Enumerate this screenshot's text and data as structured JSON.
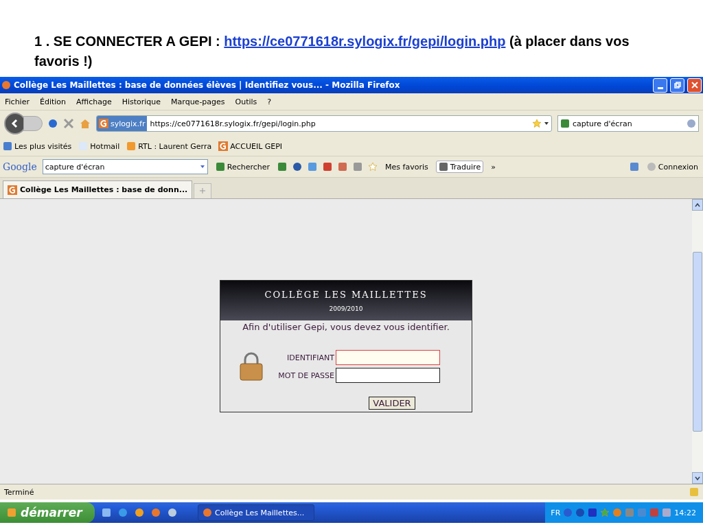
{
  "slide_heading": {
    "prefix": "1 . SE CONNECTER A GEPI : ",
    "link": "https://ce0771618r.sylogix.fr/gepi/login.php",
    "suffix": " (à placer dans vos favoris !)"
  },
  "window": {
    "title": "Collège Les Maillettes : base de données élèves | Identifiez vous... - Mozilla Firefox"
  },
  "menu": [
    "Fichier",
    "Édition",
    "Affichage",
    "Historique",
    "Marque-pages",
    "Outils",
    "?"
  ],
  "address_bar": {
    "site_badge": "sylogix.fr",
    "url": "https://ce0771618r.sylogix.fr/gepi/login.php"
  },
  "search_field": {
    "value": "capture d'écran"
  },
  "bookmarks": [
    "Les plus visités",
    "Hotmail",
    "RTL : Laurent Gerra",
    "ACCUEIL GEPI"
  ],
  "google_toolbar": {
    "logo": "Google",
    "query": "capture d'écran",
    "search_button": "Rechercher",
    "favorites": "Mes favoris",
    "translate": "Traduire",
    "more": "»",
    "connect": "Connexion"
  },
  "tabs": [
    {
      "label": "Collège Les Maillettes : base de donn...",
      "selected": true
    }
  ],
  "login": {
    "school": "COLLÈGE LES MAILLETTES",
    "year": "2009/2010",
    "intro": "Afin d'utiliser Gepi, vous devez vous identifier.",
    "fields": [
      {
        "label": "IDENTIFIANT",
        "focused": true
      },
      {
        "label": "MOT DE PASSE",
        "focused": false
      }
    ],
    "submit": "VALIDER"
  },
  "status_bar": {
    "text": "Terminé"
  },
  "taskbar": {
    "start": "démarrer",
    "task": "Collège Les Maillettes...",
    "language": "FR",
    "clock": "14:22"
  }
}
